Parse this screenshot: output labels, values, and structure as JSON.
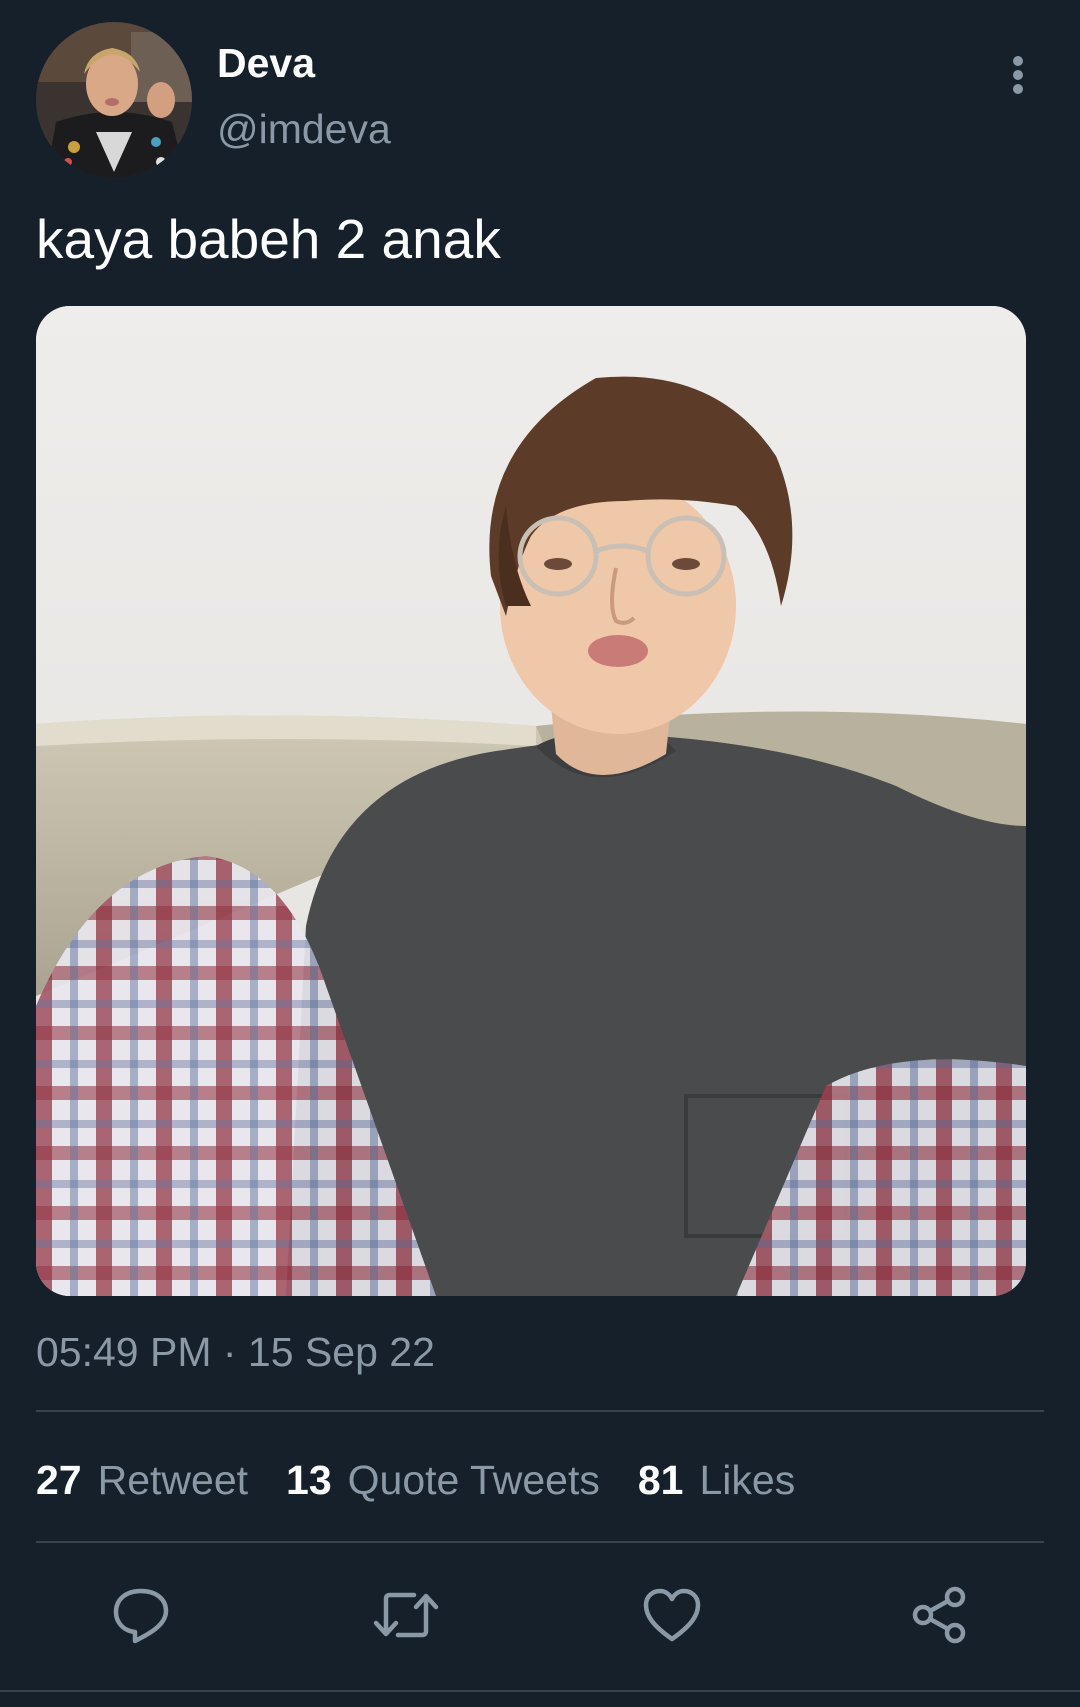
{
  "author": {
    "display_name": "Deva",
    "handle": "@imdeva"
  },
  "tweet": {
    "text": "kaya babeh 2 anak",
    "timestamp": "05:49 PM · 15 Sep 22"
  },
  "stats": [
    {
      "count": "27",
      "label": "Retweet"
    },
    {
      "count": "13",
      "label": "Quote Tweets"
    },
    {
      "count": "81",
      "label": "Likes"
    }
  ],
  "icons": {
    "more": "vertical-ellipsis-icon",
    "reply": "reply-icon",
    "retweet": "retweet-icon",
    "like": "heart-icon",
    "share": "share-icon"
  },
  "colors": {
    "background": "#15202b",
    "secondary_text": "#8b98a5",
    "divider": "#38444d"
  }
}
